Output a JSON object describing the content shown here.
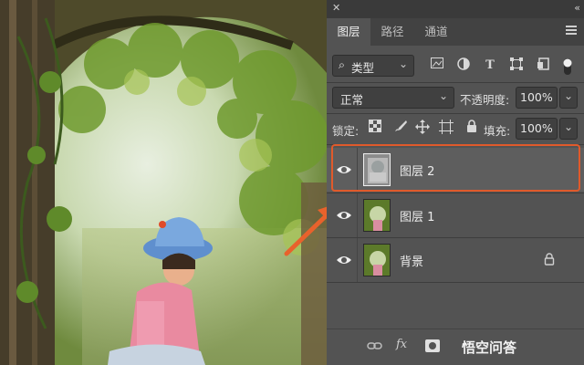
{
  "panel": {
    "tabs": [
      {
        "label": "图层",
        "active": true
      },
      {
        "label": "路径",
        "active": false
      },
      {
        "label": "通道",
        "active": false
      }
    ],
    "filter": {
      "label": "类型"
    },
    "blend_mode": "正常",
    "opacity": {
      "label": "不透明度:",
      "value": "100%"
    },
    "lock": {
      "label": "锁定:"
    },
    "fill": {
      "label": "填充:",
      "value": "100%"
    },
    "layers": [
      {
        "name": "图层 2",
        "selected": true,
        "visible": true
      },
      {
        "name": "图层 1",
        "selected": false,
        "visible": true
      },
      {
        "name": "背景",
        "selected": false,
        "visible": true,
        "locked": true
      }
    ],
    "bottom": {
      "fx": "fx"
    }
  },
  "watermark": "悟空问答",
  "colors": {
    "highlight": "#e05a2b",
    "arrow": "#e8622c",
    "panel_bg": "#535353"
  }
}
